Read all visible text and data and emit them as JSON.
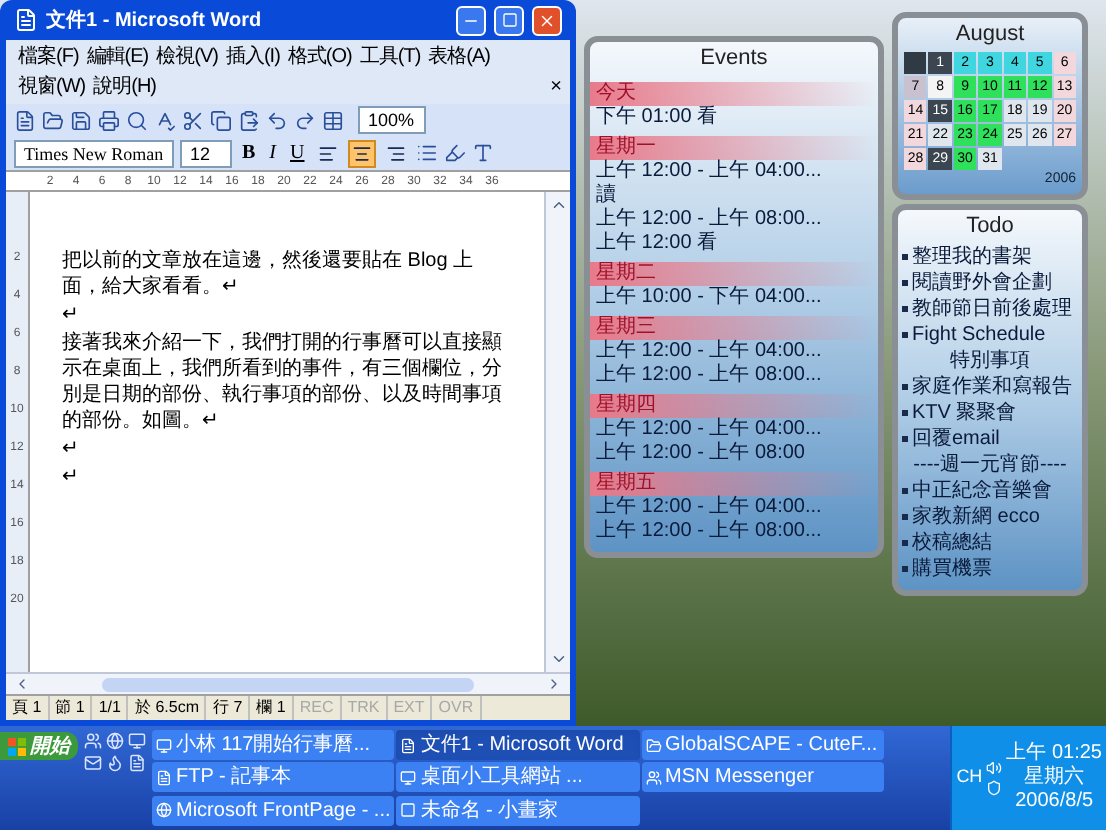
{
  "word_window": {
    "title": "文件1 - Microsoft Word",
    "menu": [
      "檔案(F)",
      "編輯(E)",
      "檢視(V)",
      "插入(I)",
      "格式(O)",
      "工具(T)",
      "表格(A)",
      "視窗(W)",
      "說明(H)"
    ],
    "close_document": "×",
    "standard_toolbar": {
      "zoom": "100%"
    },
    "formatting_toolbar": {
      "font": "Times New Roman",
      "size": "12",
      "style_buttons": [
        "B",
        "I",
        "U"
      ],
      "alignment": [
        {
          "selected": false
        },
        {
          "selected": true
        },
        {
          "selected": false
        }
      ]
    },
    "ruler": [
      "2",
      "4",
      "6",
      "8",
      "10",
      "12",
      "14",
      "16",
      "18",
      "20",
      "22",
      "24",
      "26",
      "28",
      "30",
      "32",
      "34",
      "36"
    ],
    "vertical_ruler": [
      "2",
      "4",
      "6",
      "8",
      "10",
      "12",
      "14",
      "16",
      "18",
      "20"
    ],
    "document": {
      "paragraphs": [
        "把以前的文章放在這邊，然後還要貼在 Blog 上面，給大家看看。↵",
        "↵",
        "接著我來介紹一下，我們打開的行事曆可以直接顯示在桌面上，我們所看到的事件，有三個欄位，分別是日期的部份、執行事項的部份、以及時間事項的部份。如圖。↵",
        "↵",
        "↵"
      ]
    },
    "status_bar": [
      {
        "text": "頁 1",
        "disabled": false
      },
      {
        "text": "節 1",
        "disabled": false
      },
      {
        "text": "1/1",
        "disabled": false
      },
      {
        "text": "於 6.5cm",
        "disabled": false
      },
      {
        "text": "行 7",
        "disabled": false
      },
      {
        "text": "欄 1",
        "disabled": false
      },
      {
        "text": "REC",
        "disabled": true
      },
      {
        "text": "TRK",
        "disabled": true
      },
      {
        "text": "EXT",
        "disabled": true
      },
      {
        "text": "OVR",
        "disabled": true
      }
    ]
  },
  "events": {
    "title": "Events",
    "items": [
      {
        "kind": "day",
        "text": "今天"
      },
      {
        "kind": "event",
        "text": "下午 01:00 看"
      },
      {
        "kind": "day",
        "text": "星期一"
      },
      {
        "kind": "event",
        "text": "上午 12:00 - 上午 04:00..."
      },
      {
        "kind": "event",
        "text": "讀"
      },
      {
        "kind": "event",
        "text": "上午 12:00 - 上午 08:00..."
      },
      {
        "kind": "event",
        "text": "上午 12:00 看"
      },
      {
        "kind": "day",
        "text": "星期二"
      },
      {
        "kind": "event",
        "text": "上午 10:00 - 下午 04:00..."
      },
      {
        "kind": "day",
        "text": "星期三"
      },
      {
        "kind": "event",
        "text": "上午 12:00 - 上午 04:00..."
      },
      {
        "kind": "event",
        "text": "上午 12:00 - 上午 08:00..."
      },
      {
        "kind": "day",
        "text": "星期四"
      },
      {
        "kind": "event",
        "text": "上午 12:00 - 上午 04:00..."
      },
      {
        "kind": "event",
        "text": "上午 12:00 - 上午 08:00"
      },
      {
        "kind": "day",
        "text": "星期五"
      },
      {
        "kind": "event",
        "text": "上午 12:00 - 上午 04:00..."
      },
      {
        "kind": "event",
        "text": "上午 12:00 - 上午 08:00..."
      }
    ]
  },
  "calendar": {
    "month": "August",
    "year": "2006",
    "leading_cells": [
      {
        "color": "#2f3a44"
      }
    ],
    "days": [
      {
        "day": "1",
        "color": "#3b4650"
      },
      {
        "day": "2",
        "color": "#3fd6e0"
      },
      {
        "day": "3",
        "color": "#3fd6e0"
      },
      {
        "day": "4",
        "color": "#3fd6e0"
      },
      {
        "day": "5",
        "color": "#3fd6e0"
      },
      {
        "day": "6",
        "color": "#f2d8dc"
      },
      {
        "day": "7",
        "color": "#c9c0d0"
      },
      {
        "day": "8",
        "color": "#f4f4f4"
      },
      {
        "day": "9",
        "color": "#2ee05a"
      },
      {
        "day": "10",
        "color": "#2ee05a"
      },
      {
        "day": "11",
        "color": "#2ee05a"
      },
      {
        "day": "12",
        "color": "#2ee05a"
      },
      {
        "day": "13",
        "color": "#f2d8dc"
      },
      {
        "day": "14",
        "color": "#f2d8dc"
      },
      {
        "day": "15",
        "color": "#3b4650"
      },
      {
        "day": "16",
        "color": "#2ee05a"
      },
      {
        "day": "17",
        "color": "#2ee05a"
      },
      {
        "day": "18",
        "color": "#dfe6ee"
      },
      {
        "day": "19",
        "color": "#dfe6ee"
      },
      {
        "day": "20",
        "color": "#f2d8dc"
      },
      {
        "day": "21",
        "color": "#f2d8dc"
      },
      {
        "day": "22",
        "color": "#dfe6ee"
      },
      {
        "day": "23",
        "color": "#2ee05a"
      },
      {
        "day": "24",
        "color": "#2ee05a"
      },
      {
        "day": "25",
        "color": "#dfe6ee"
      },
      {
        "day": "26",
        "color": "#dfe6ee"
      },
      {
        "day": "27",
        "color": "#f2d8dc"
      },
      {
        "day": "28",
        "color": "#f2d8dc"
      },
      {
        "day": "29",
        "color": "#3b4650"
      },
      {
        "day": "30",
        "color": "#2ee05a"
      },
      {
        "day": "31",
        "color": "#dfe6ee"
      }
    ]
  },
  "todo": {
    "title": "Todo",
    "items": [
      {
        "kind": "task",
        "text": "整理我的書架"
      },
      {
        "kind": "task",
        "text": "閱讀野外會企劃"
      },
      {
        "kind": "task",
        "text": "教師節日前後處理"
      },
      {
        "kind": "task",
        "text": "Fight Schedule"
      },
      {
        "kind": "heading",
        "text": "特別事項"
      },
      {
        "kind": "task",
        "text": "家庭作業和寫報告"
      },
      {
        "kind": "task",
        "text": "KTV 聚聚會"
      },
      {
        "kind": "task",
        "text": "回覆email"
      },
      {
        "kind": "heading",
        "text": "----週一元宵節----"
      },
      {
        "kind": "task",
        "text": "中正紀念音樂會"
      },
      {
        "kind": "task",
        "text": "家教新網 ecco"
      },
      {
        "kind": "task",
        "text": "校稿總結"
      },
      {
        "kind": "task",
        "text": "購買機票"
      }
    ]
  },
  "taskbar": {
    "start": "開始",
    "buttons": [
      {
        "text": "小林 117開始行事曆...",
        "selected": false
      },
      {
        "text": "文件1 - Microsoft Word",
        "selected": true
      },
      {
        "text": "GlobalSCAPE - CuteF...",
        "selected": false
      },
      {
        "text": "FTP - 記事本",
        "selected": false
      },
      {
        "text": "桌面小工具網站 ...",
        "selected": false
      },
      {
        "text": "MSN Messenger",
        "selected": false
      },
      {
        "text": "Microsoft FrontPage - ...",
        "selected": false
      },
      {
        "text": "未命名 - 小畫家",
        "selected": false
      }
    ],
    "language": "CH",
    "clock": [
      "上午 01:25",
      "星期六",
      "2006/8/5"
    ]
  }
}
